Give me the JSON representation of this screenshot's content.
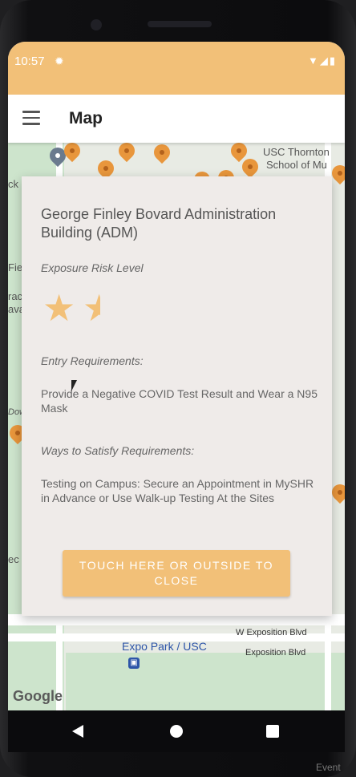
{
  "status_bar": {
    "time": "10:57",
    "settings_icon": "gear-icon",
    "indicators": "▼◢▮"
  },
  "app_bar": {
    "menu_icon": "hamburger-icon",
    "title": "Map"
  },
  "map": {
    "labels": [
      "USC Thornton",
      "School of Mu",
      "ck",
      "Fie",
      "rac",
      "ava",
      "Dow",
      "ec",
      "W Exposition Blvd",
      "Exposition Blvd",
      "Event"
    ],
    "station_label": "Expo Park / USC",
    "google_logo": "Google"
  },
  "popup": {
    "title": "George Finley Bovard Administration Building (ADM)",
    "risk_label": "Exposure Risk Level",
    "risk_rating": 1.5,
    "risk_max": 5,
    "entry_label": "Entry Requirements:",
    "entry_text": "Provide a Negative COVID Test Result and Wear a N95 Mask",
    "ways_label": "Ways to Satisfy Requirements:",
    "ways_text": "Testing on Campus: Secure an Appointment in MySHR in Advance or Use Walk-up Testing At the Sites",
    "close_button": "TOUCH HERE OR OUTSIDE TO CLOSE"
  },
  "colors": {
    "accent": "#f2c078",
    "pin": "#e8963c"
  }
}
